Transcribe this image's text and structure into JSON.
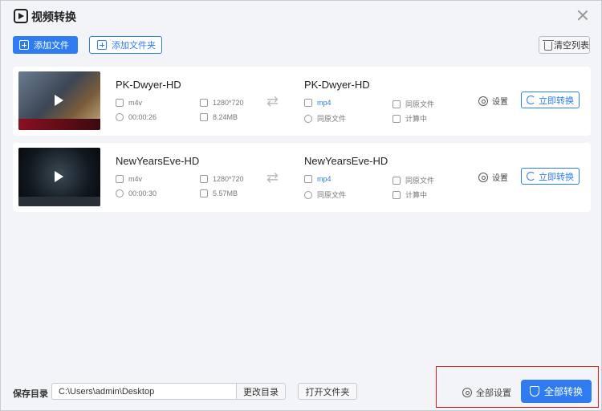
{
  "window": {
    "title": "视频转换"
  },
  "toolbar": {
    "add_file": "添加文件",
    "add_folder": "添加文件夹",
    "clear_list": "清空列表"
  },
  "items": [
    {
      "name": "PK-Dwyer-HD",
      "src": {
        "format": "m4v",
        "resolution": "1280*720",
        "duration": "00:00:26",
        "size": "8.24MB"
      },
      "dst": {
        "name": "PK-Dwyer-HD",
        "format": "mp4",
        "resolution": "同原文件",
        "duration": "同原文件",
        "size": "计算中"
      },
      "settings_label": "设置",
      "convert_label": "立即转换"
    },
    {
      "name": "NewYearsEve-HD",
      "src": {
        "format": "m4v",
        "resolution": "1280*720",
        "duration": "00:00:30",
        "size": "5.57MB"
      },
      "dst": {
        "name": "NewYearsEve-HD",
        "format": "mp4",
        "resolution": "同原文件",
        "duration": "同原文件",
        "size": "计算中"
      },
      "settings_label": "设置",
      "convert_label": "立即转换"
    }
  ],
  "footer": {
    "save_dir_label": "保存目录",
    "save_path": "C:\\Users\\admin\\Desktop",
    "change_dir": "更改目录",
    "open_folder": "打开文件夹",
    "all_settings": "全部设置",
    "all_convert": "全部转换"
  },
  "colors": {
    "accent": "#2f7bf0",
    "highlight": "#e02020"
  }
}
